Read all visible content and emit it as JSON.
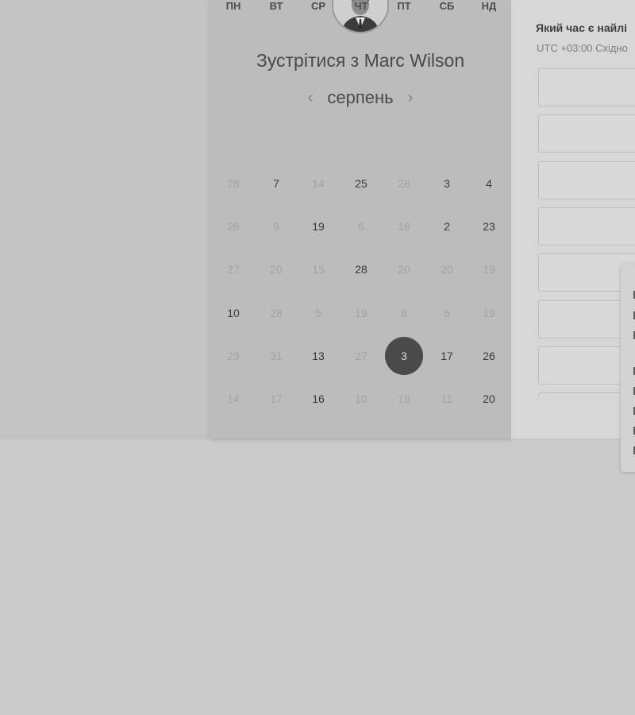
{
  "booking": {
    "title": "Зустрітися з Marc Wilson",
    "month": "серпень",
    "prev_icon": "‹",
    "next_icon": "›",
    "weekdays": [
      "ПН",
      "ВТ",
      "СР",
      "ЧТ",
      "ПТ",
      "СБ",
      "НД"
    ],
    "days": [
      [
        "28",
        "7",
        "14",
        "25",
        "28",
        "3",
        "4"
      ],
      [
        "26",
        "9",
        "19",
        "6",
        "18",
        "2",
        "23"
      ],
      [
        "27",
        "20",
        "15",
        "28",
        "20",
        "20",
        "19"
      ],
      [
        "10",
        "28",
        "5",
        "19",
        "6",
        "6",
        "19"
      ],
      [
        "29",
        "31",
        "13",
        "27",
        "3",
        "17",
        "26"
      ],
      [
        "14",
        "17",
        "16",
        "10",
        "18",
        "11",
        "20"
      ]
    ],
    "available": [
      [
        false,
        true,
        false,
        true,
        false,
        true,
        true
      ],
      [
        false,
        false,
        true,
        false,
        false,
        true,
        true
      ],
      [
        false,
        false,
        false,
        true,
        false,
        false,
        false
      ],
      [
        true,
        false,
        false,
        false,
        false,
        false,
        false
      ],
      [
        false,
        false,
        true,
        false,
        true,
        true,
        true
      ],
      [
        false,
        false,
        true,
        false,
        false,
        false,
        true
      ]
    ],
    "selected": {
      "row": 4,
      "col": 4
    }
  },
  "times": {
    "question": "Який час є найлі",
    "timezone": "UTC +03:00 Східно",
    "slot_count": 8
  },
  "colors": {
    "selected_day_bg": "#4a4a4a"
  }
}
